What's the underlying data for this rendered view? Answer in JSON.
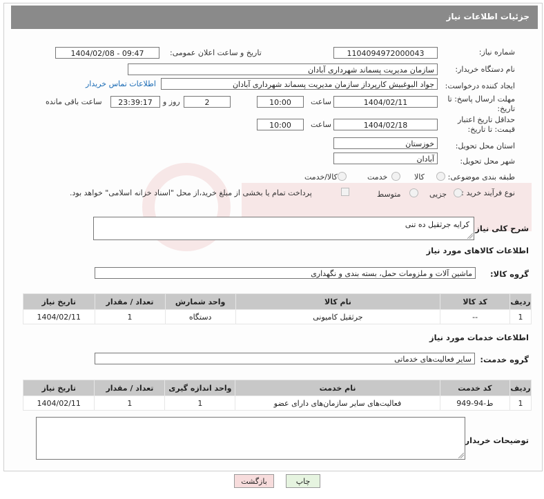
{
  "header": {
    "title": "جزئیات اطلاعات نیاز"
  },
  "labels": {
    "need_number": "شماره نیاز:",
    "announce_datetime": "تاریخ و ساعت اعلان عمومی:",
    "buyer_org": "نام دستگاه خریدار:",
    "requester": "ایجاد کننده درخواست:",
    "contact_link": "اطلاعات تماس خریدار",
    "reply_deadline": "مهلت ارسال پاسخ: تا تاریخ:",
    "time": "ساعت",
    "day_and": "روز و",
    "remaining": "ساعت باقی مانده",
    "price_validity": "حداقل تاریخ اعتبار قیمت: تا تاریخ:",
    "delivery_province": "استان محل تحویل:",
    "delivery_city": "شهر محل تحویل:",
    "category": "طبقه بندی موضوعی:",
    "process_type": "نوع فرآیند خرید :",
    "general_desc": "شرح کلی نیاز:",
    "goods_info": "اطلاعات کالاهای مورد نیاز",
    "goods_group": "گروه کالا:",
    "services_info": "اطلاعات خدمات مورد نیاز",
    "service_group": "گروه خدمت:",
    "buyer_notes": "توضیحات خریدار:"
  },
  "values": {
    "need_number": "1104094972000043",
    "announce_datetime": "1404/02/08 - 09:47",
    "buyer_org": "سازمان مدیریت پسماند شهرداری آبادان",
    "requester": "جواد البوغبیش کارپرداز سازمان مدیریت پسماند شهرداری آبادان",
    "reply_date": "1404/02/11",
    "reply_time": "10:00",
    "reply_days": "2",
    "reply_remaining": "23:39:17",
    "validity_date": "1404/02/18",
    "validity_time": "10:00",
    "province": "خوزستان",
    "city": "آبادان",
    "general_desc": "کرایه جرثقیل ده تنی",
    "goods_group": "ماشین آلات و ملزومات حمل، بسته بندی و نگهداری",
    "service_group": "سایر فعالیت‌های خدماتی",
    "buyer_notes": ""
  },
  "category_options": [
    "کالا",
    "خدمت",
    "کالا/خدمت"
  ],
  "process_options": [
    "جزیی",
    "متوسط"
  ],
  "payment_note": "پرداخت تمام یا بخشی از مبلغ خرید،از محل \"اسناد خزانه اسلامی\" خواهد بود.",
  "goods_table": {
    "headers": [
      "ردیف",
      "کد کالا",
      "نام کالا",
      "واحد شمارش",
      "تعداد / مقدار",
      "تاریخ نیاز"
    ],
    "rows": [
      [
        "1",
        "--",
        "جرثقیل کامیونی",
        "دستگاه",
        "1",
        "1404/02/11"
      ]
    ]
  },
  "services_table": {
    "headers": [
      "ردیف",
      "کد خدمت",
      "نام خدمت",
      "واحد اندازه گیری",
      "تعداد / مقدار",
      "تاریخ نیاز"
    ],
    "rows": [
      [
        "1",
        "ط-94-949",
        "فعالیت‌های سایر سازمان‌های دارای عضو",
        "1",
        "1",
        "1404/02/11"
      ]
    ]
  },
  "buttons": {
    "print": "چاپ",
    "back": "بازگشت"
  },
  "colors": {
    "header_bg": "#8a8a8a",
    "table_header_bg": "#c8c8c8",
    "link": "#1a6bb5",
    "print_btn": "#e6f4e0",
    "back_btn": "#f7dcdc"
  }
}
